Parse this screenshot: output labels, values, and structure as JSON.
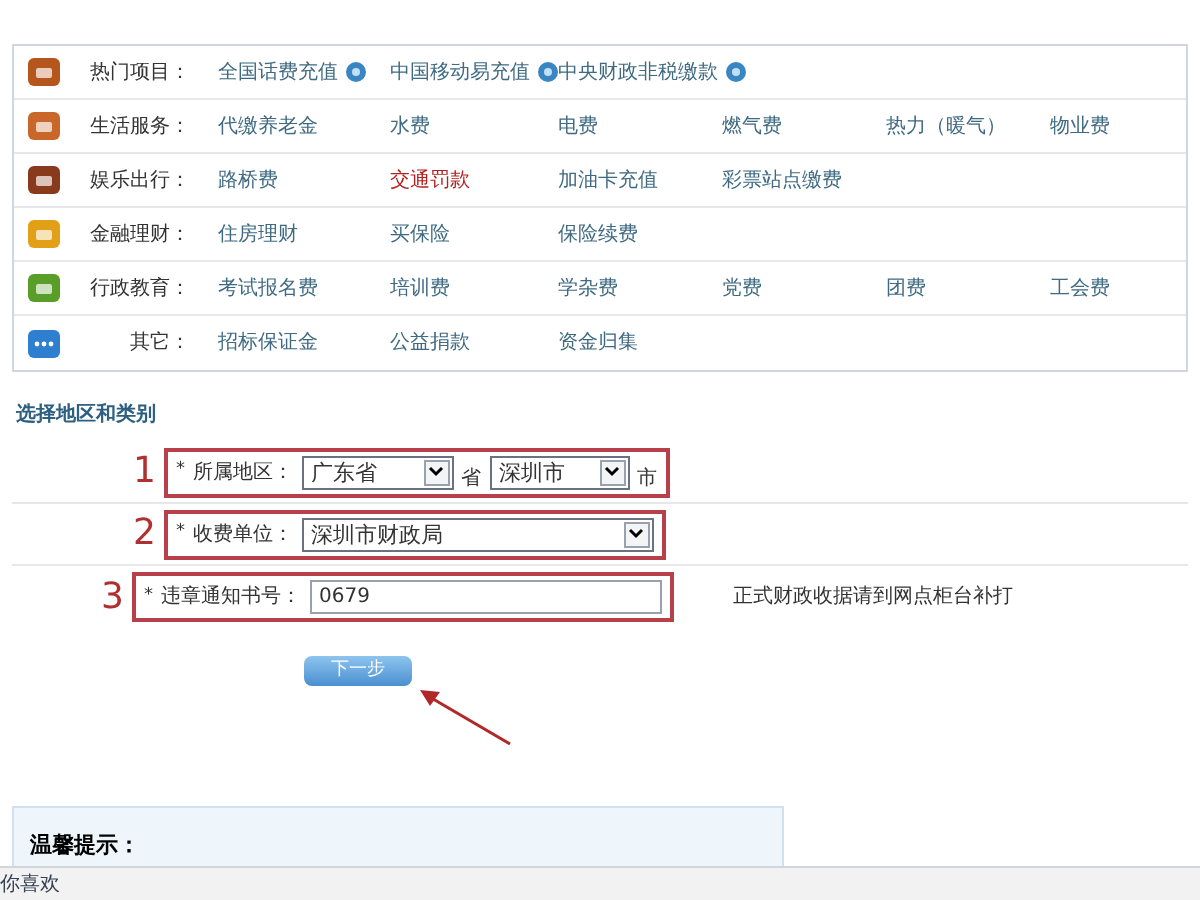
{
  "categories": [
    {
      "label": "热门项目：",
      "kind": "hot",
      "items": [
        {
          "text": "全国话费充值",
          "help": true,
          "highlight": false
        },
        {
          "text": "中国移动易充值",
          "help": true,
          "highlight": false
        },
        {
          "text": "中央财政非税缴款",
          "help": true,
          "highlight": false
        }
      ]
    },
    {
      "label": "生活服务：",
      "kind": "house",
      "items": [
        {
          "text": "代缴养老金",
          "help": false,
          "highlight": false
        },
        {
          "text": "水费",
          "help": false,
          "highlight": false
        },
        {
          "text": "电费",
          "help": false,
          "highlight": false
        },
        {
          "text": "燃气费",
          "help": false,
          "highlight": false
        },
        {
          "text": "热力（暖气）",
          "help": false,
          "highlight": false
        },
        {
          "text": "物业费",
          "help": false,
          "highlight": false
        }
      ]
    },
    {
      "label": "娱乐出行：",
      "kind": "film",
      "items": [
        {
          "text": "路桥费",
          "help": false,
          "highlight": false
        },
        {
          "text": "交通罚款",
          "help": false,
          "highlight": true
        },
        {
          "text": "加油卡充值",
          "help": false,
          "highlight": false
        },
        {
          "text": "彩票站点缴费",
          "help": false,
          "highlight": false
        }
      ]
    },
    {
      "label": "金融理财：",
      "kind": "coins",
      "items": [
        {
          "text": "住房理财",
          "help": false,
          "highlight": false
        },
        {
          "text": "买保险",
          "help": false,
          "highlight": false
        },
        {
          "text": "保险续费",
          "help": false,
          "highlight": false
        }
      ]
    },
    {
      "label": "行政教育：",
      "kind": "cap",
      "items": [
        {
          "text": "考试报名费",
          "help": false,
          "highlight": false
        },
        {
          "text": "培训费",
          "help": false,
          "highlight": false
        },
        {
          "text": "学杂费",
          "help": false,
          "highlight": false
        },
        {
          "text": "党费",
          "help": false,
          "highlight": false
        },
        {
          "text": "团费",
          "help": false,
          "highlight": false
        },
        {
          "text": "工会费",
          "help": false,
          "highlight": false
        }
      ]
    },
    {
      "label": "其它：",
      "kind": "more",
      "items": [
        {
          "text": "招标保证金",
          "help": false,
          "highlight": false
        },
        {
          "text": "公益捐款",
          "help": false,
          "highlight": false
        },
        {
          "text": "资金归集",
          "help": false,
          "highlight": false
        }
      ]
    }
  ],
  "section_title": "选择地区和类别",
  "form": [
    {
      "number": "1",
      "required": "*",
      "label": "所属地区：",
      "kind": "region",
      "province": "广东省",
      "province_suffix": "省",
      "city": "深圳市",
      "city_suffix": "市"
    },
    {
      "number": "2",
      "required": "*",
      "label": "收费单位：",
      "kind": "select",
      "value": "深圳市财政局"
    },
    {
      "number": "3",
      "required": "*",
      "label": "违章通知书号：",
      "kind": "input",
      "value": "0679",
      "note": "正式财政收据请到网点柜台补打"
    }
  ],
  "next_button": "下一步",
  "tips_title": "温馨提示：",
  "bottom_bar": "你喜欢"
}
